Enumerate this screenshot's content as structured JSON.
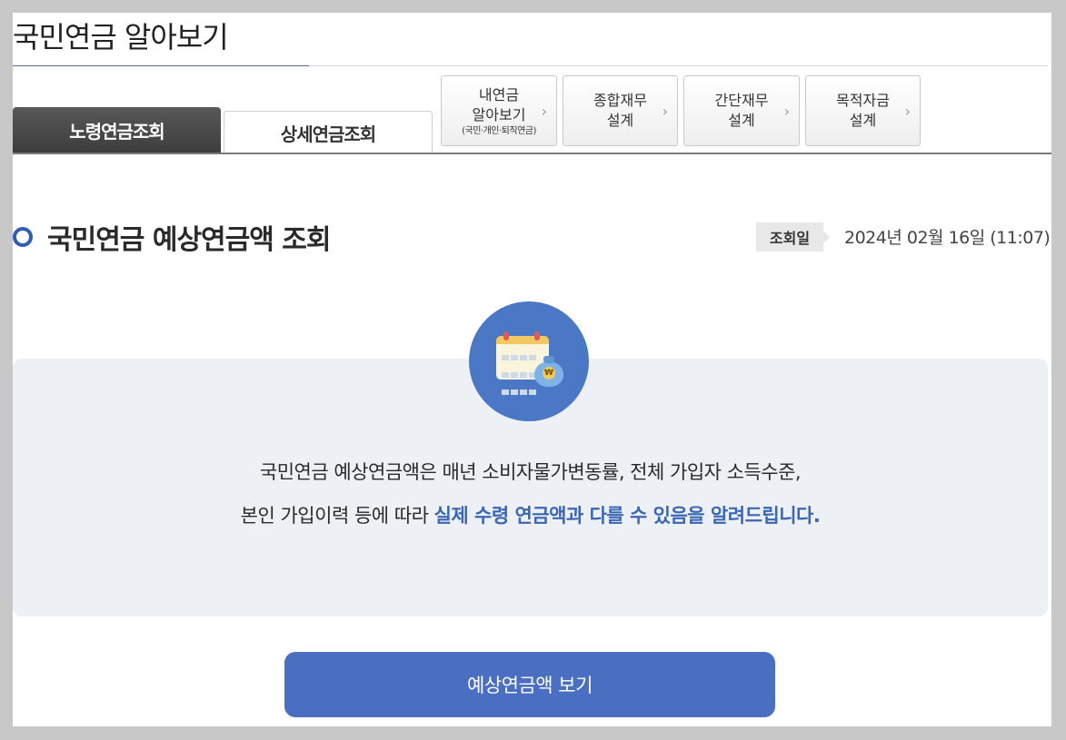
{
  "page": {
    "title": "국민연금 알아보기"
  },
  "tabs": [
    {
      "label": "노령연금조회",
      "active": true
    },
    {
      "label": "상세연금조회",
      "active": false
    }
  ],
  "quick_links": [
    {
      "line1": "내연금",
      "line2": "알아보기",
      "sub": "(국민·개인·퇴직연금)"
    },
    {
      "line1": "종합재무",
      "line2": "설계"
    },
    {
      "line1": "간단재무",
      "line2": "설계"
    },
    {
      "line1": "목적자금",
      "line2": "설계"
    }
  ],
  "section": {
    "title": "국민연금 예상연금액 조회",
    "date_label": "조회일",
    "date_value": "2024년 02월 16일 (11:07)"
  },
  "notice": {
    "line1": "국민연금 예상연금액은 매년 소비자물가변동률, 전체 가입자 소득수준,",
    "line2_plain": "본인 가입이력 등에 따라 ",
    "line2_highlight": "실제 수령 연금액과 다를 수 있음을 알려드립니다."
  },
  "icon": {
    "name": "calendar-money-icon",
    "currency_mark": "₩"
  },
  "cta": {
    "label": "예상연금액 보기"
  },
  "colors": {
    "accent": "#4a6ec1",
    "highlight": "#3a66b5",
    "panel_bg": "#edf1f5",
    "tab_active": "#4a4a4a"
  }
}
